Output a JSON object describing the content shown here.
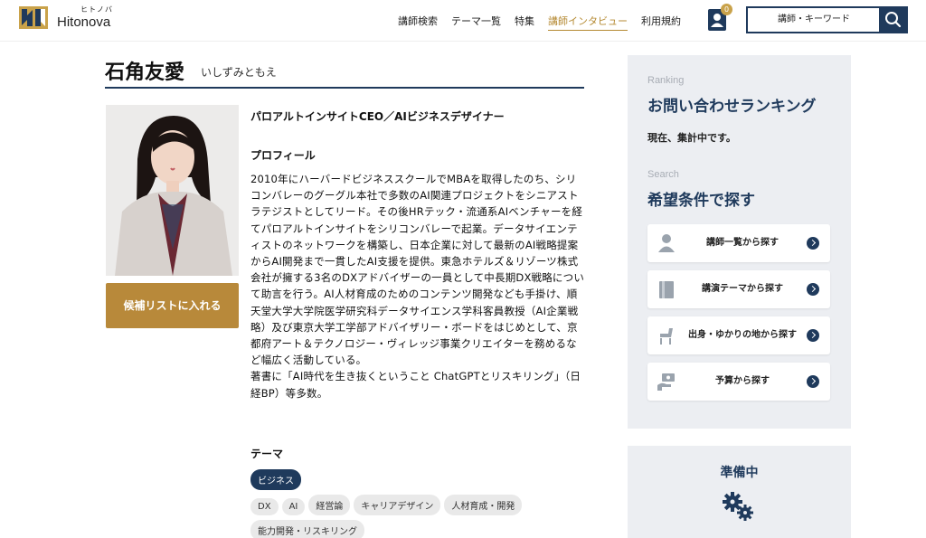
{
  "header": {
    "logo_kana": "ヒトノバ",
    "logo_name": "Hitonova",
    "nav": [
      "講師検索",
      "テーマ一覧",
      "特集",
      "講師インタビュー",
      "利用規約"
    ],
    "active_nav_index": 3,
    "user_badge_count": "0",
    "search_placeholder": "講師・キーワード"
  },
  "profile": {
    "name": "石角友愛",
    "name_kana": "いしずみともえ",
    "title": "パロアルトインサイトCEO／AIビジネスデザイナー",
    "profile_heading": "プロフィール",
    "bio": "2010年にハーバードビジネススクールでMBAを取得したのち、シリコンバレーのグーグル本社で多数のAI関連プロジェクトをシニアストラテジストとしてリード。その後HRテック・流通系AIベンチャーを経てパロアルトインサイトをシリコンバレーで起業。データサイエンティストのネットワークを構築し、日本企業に対して最新のAI戦略提案からAI開発まで一貫したAI支援を提供。東急ホテルズ＆リゾーツ株式会社が擁する3名のDXアドバイザーの一員として中長期DX戦略について助言を行う。AI人材育成のためのコンテンツ開発なども手掛け、順天堂大学大学院医学研究科データサイエンス学科客員教授（AI企業戦略）及び東京大学工学部アドバイザリー・ボードをはじめとして、京都府アート＆テクノロジー・ヴィレッジ事業クリエイターを務めるなど幅広く活動している。",
    "bio_line2": "著書に「AI時代を生き抜くということ ChatGPTとリスキリング」（日経BP）等多数。",
    "candidate_button": "候補リストに入れる",
    "theme_heading": "テーマ",
    "tags": [
      "ビジネス",
      "DX",
      "AI",
      "経営論",
      "キャリアデザイン",
      "人材育成・開発",
      "能力開発・リスキリング"
    ]
  },
  "sidebar": {
    "ranking_eyebrow": "Ranking",
    "ranking_title": "お問い合わせランキング",
    "ranking_note": "現在、集計中です。",
    "search_eyebrow": "Search",
    "search_title": "希望条件で探す",
    "buttons": [
      {
        "label": "講師一覧から探す",
        "icon": "person-icon"
      },
      {
        "label": "講演テーマから探す",
        "icon": "book-icon"
      },
      {
        "label": "出身・ゆかりの地から探す",
        "icon": "chair-icon"
      },
      {
        "label": "予算から探す",
        "icon": "money-hand-icon"
      }
    ],
    "prep_title": "準備中"
  },
  "colors": {
    "navy": "#1f3a5c",
    "gold": "#b8893a",
    "panel": "#eceef2"
  }
}
